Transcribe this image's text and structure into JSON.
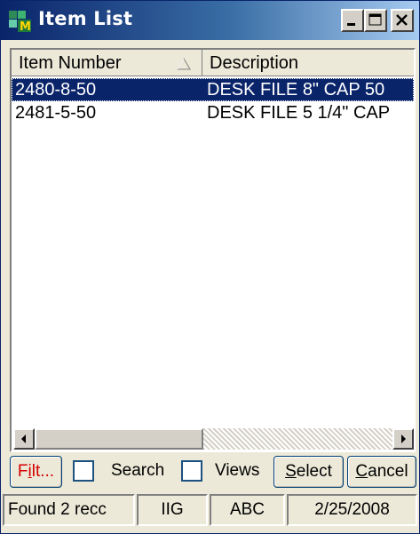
{
  "window": {
    "title": "Item List",
    "title_gradient": [
      "#0a246a",
      "#a6caf0"
    ]
  },
  "list": {
    "columns": [
      {
        "label": "Item Number",
        "sort": "ascending"
      },
      {
        "label": "Description"
      }
    ],
    "rows": [
      {
        "item_number": "2480-8-50",
        "description": "DESK FILE 8\" CAP 50",
        "selected": true
      },
      {
        "item_number": "2481-5-50",
        "description": "DESK FILE 5 1/4\" CAP",
        "selected": false
      }
    ]
  },
  "toolbar": {
    "filter_label": "Filt...",
    "filter_hotkey": "i",
    "search_label": "Search",
    "views_label": "Views",
    "select_label": "Select",
    "cancel_label": "Cancel"
  },
  "statusbar": {
    "records": "Found 2 recc",
    "company": "IIG",
    "user": "ABC",
    "date": "2/25/2008"
  },
  "colors": {
    "selection": "#0a246a",
    "filter_text": "#d40000",
    "face": "#ece9d8"
  },
  "icons": [
    "app-icon",
    "minimize-icon",
    "maximize-icon",
    "close-icon",
    "sort-ascending-icon",
    "scroll-left-icon",
    "scroll-right-icon"
  ]
}
